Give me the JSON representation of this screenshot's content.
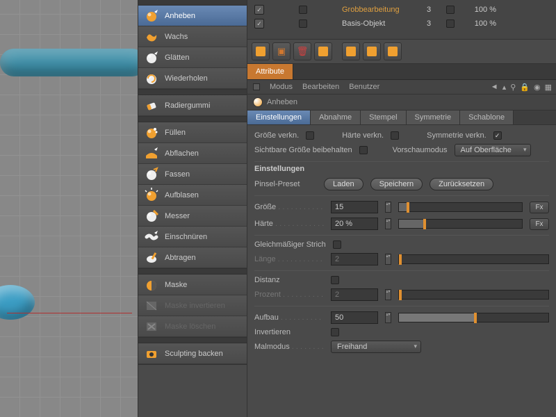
{
  "viewport": {},
  "tools": {
    "group1": [
      {
        "key": "anheben",
        "label": "Anheben",
        "selected": true
      },
      {
        "key": "wachs",
        "label": "Wachs"
      },
      {
        "key": "glaetten",
        "label": "Glätten"
      },
      {
        "key": "wiederholen",
        "label": "Wiederholen"
      }
    ],
    "group2": [
      {
        "key": "radiergummi",
        "label": "Radiergummi"
      }
    ],
    "group3": [
      {
        "key": "fuellen",
        "label": "Füllen"
      },
      {
        "key": "abflachen",
        "label": "Abflachen"
      },
      {
        "key": "fassen",
        "label": "Fassen"
      },
      {
        "key": "aufblasen",
        "label": "Aufblasen"
      },
      {
        "key": "messer",
        "label": "Messer"
      },
      {
        "key": "einschnueren",
        "label": "Einschnüren"
      },
      {
        "key": "abtragen",
        "label": "Abtragen"
      }
    ],
    "group4": [
      {
        "key": "maske",
        "label": "Maske"
      },
      {
        "key": "maske-invertieren",
        "label": "Maske invertieren",
        "disabled": true
      },
      {
        "key": "maske-loeschen",
        "label": "Maske löschen",
        "disabled": true
      }
    ],
    "group5": [
      {
        "key": "sculpting-backen",
        "label": "Sculpting backen"
      }
    ]
  },
  "objects": [
    {
      "name": "Grobbearbeitung",
      "highlight": true,
      "col": 3,
      "pct": "100 %"
    },
    {
      "name": "Basis-Objekt",
      "highlight": false,
      "col": 3,
      "pct": "100 %"
    }
  ],
  "attr_tab": "Attribute",
  "menus": {
    "modus": "Modus",
    "bearbeiten": "Bearbeiten",
    "benutzer": "Benutzer"
  },
  "attr_title": "Anheben",
  "subtabs": [
    "Einstellungen",
    "Abnahme",
    "Stempel",
    "Symmetrie",
    "Schablone"
  ],
  "row1": {
    "groesse_verkn": "Größe verkn.",
    "haerte_verkn": "Härte verkn.",
    "symmetrie_verkn": "Symmetrie verkn."
  },
  "row2": {
    "sichtbare": "Sichtbare Größe beibehalten",
    "vorschau": "Vorschaumodus",
    "vorschau_value": "Auf Oberfläche"
  },
  "section": "Einstellungen",
  "preset": {
    "label": "Pinsel-Preset",
    "laden": "Laden",
    "speichern": "Speichern",
    "reset": "Zurücksetzen"
  },
  "groesse": {
    "label": "Größe",
    "value": "15",
    "fx": "Fx"
  },
  "haerte": {
    "label": "Härte",
    "value": "20 %",
    "fx": "Fx"
  },
  "gleich": {
    "label": "Gleichmäßiger Strich"
  },
  "laenge": {
    "label": "Länge",
    "value": "2"
  },
  "distanz": {
    "label": "Distanz"
  },
  "prozent": {
    "label": "Prozent",
    "value": "2"
  },
  "aufbau": {
    "label": "Aufbau",
    "value": "50"
  },
  "invert": {
    "label": "Invertieren"
  },
  "malmodus": {
    "label": "Malmodus",
    "value": "Freihand"
  }
}
